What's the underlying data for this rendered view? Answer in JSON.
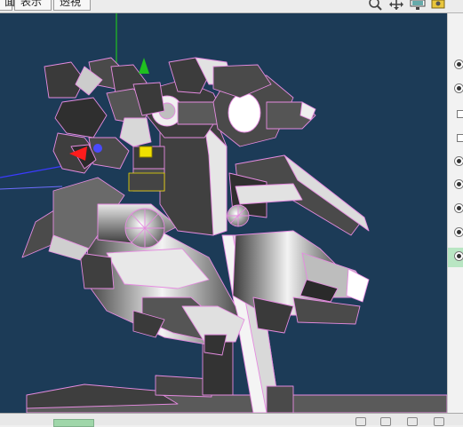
{
  "menu": {
    "tab1": "面",
    "tab2": "表示",
    "tab3": "透視"
  },
  "toolbar_icons": [
    "zoom-icon",
    "move-icon",
    "display-icon",
    "camera-icon"
  ],
  "viewport": {
    "background": "#1c3b57",
    "wire_color": "#e58be0",
    "axis_x_color": "#ff2020",
    "axis_y_color": "#20c020",
    "axis_z_color": "#3b3bff"
  },
  "right_panel": {
    "controls": [
      "radio",
      "radio",
      "check",
      "check",
      "radio",
      "radio",
      "radio",
      "radio",
      "radio"
    ]
  }
}
